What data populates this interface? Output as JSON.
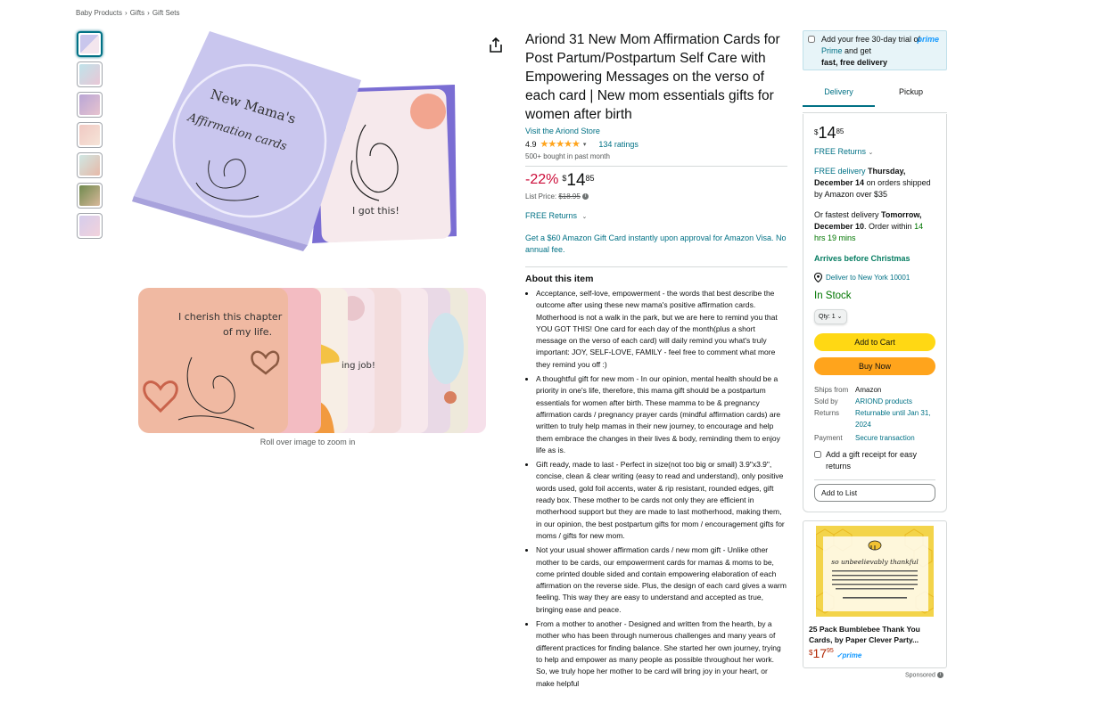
{
  "breadcrumb": {
    "items": [
      "Baby Products",
      "Gifts",
      "Gift Sets"
    ],
    "separator": "›"
  },
  "product": {
    "title": "Ariond 31 New Mom Affirmation Cards for Post Partum/Postpartum Self Care with Empowering Messages on the verso of each card | New mom essentials gifts for women after birth",
    "store_link": "Visit the Ariond Store",
    "rating": "4.9",
    "stars": "★★★★★",
    "ratings_count": "134 ratings",
    "bought": "500+ bought in past month",
    "discount": "-22%",
    "price_symbol": "$",
    "price_whole": "14",
    "price_fraction": "85",
    "list_price_label": "List Price:",
    "list_price": "$18.95",
    "free_returns": "FREE Returns",
    "gift_offer": "Get a $60 Amazon Gift Card instantly upon approval for Amazon Visa. No annual fee.",
    "zoom_hint": "Roll over image to zoom in",
    "box_title_line1": "New Mama's",
    "box_title_line2": "Affirmation cards",
    "card_text": "I got this!",
    "collage_text": "I cherish this chapter of my life.",
    "collage_text2": "ing job!"
  },
  "about": {
    "title": "About this item",
    "bullets": [
      "Acceptance, self-love, empowerment - the words that best describe the outcome after using these new mama's positive affirmation cards. Motherhood is not a walk in the park, but we are here to remind you that YOU GOT THIS! One card for each day of the month(plus a short message on the verso of each card) will daily remind you what's truly important: JOY, SELF-LOVE, FAMILY - feel free to comment what more they remind you off :)",
      "A thoughtful gift for new mom - In our opinion, mental health should be a priority in one's life, therefore, this mama gift should be a postpartum essentials for women after birth. These mamma to be & pregnancy affirmation cards / pregnancy prayer cards (mindful affirmation cards) are written to truly help mamas in their new journey, to encourage and help them embrace the changes in their lives & body, reminding them to enjoy life as is.",
      "Gift ready, made to last - Perfect in size(not too big or small) 3.9\"x3.9\", concise, clean & clear writing (easy to read and understand), only positive words used, gold foil accents, water & rip resistant, rounded edges, gift ready box. These mother to be cards not only they are efficient in motherhood support but they are made to last motherhood, making them, in our opinion, the best postpartum gifts for mom / encouragement gifts for moms / gifts for new mom.",
      "Not your usual shower affirmation cards / new mom gift - Unlike other mother to be cards, our empowerment cards for mamas & moms to be, come printed double sided and contain empowering elaboration of each affirmation on the reverse side. Plus, the design of each card gives a warm feeling. This way they are easy to understand and accepted as true, bringing ease and peace.",
      "From a mother to another - Designed and written from the hearth, by a mother who has been through numerous challenges and many years of different practices for finding balance. She started her own journey, trying to help and empower as many people as possible throughout her work. So, we truly hope her mother to be card will bring joy in your heart, or make helpful"
    ]
  },
  "prime_banner": {
    "text_pre": "Add your free 30-day trial of ",
    "prime_word": "Prime",
    "text_post": " and get",
    "bold": "fast, free delivery",
    "logo": "prime"
  },
  "tabs": {
    "delivery": "Delivery",
    "pickup": "Pickup"
  },
  "buybox": {
    "price_symbol": "$",
    "price_whole": "14",
    "price_fraction": "85",
    "free_returns": "FREE Returns",
    "free_delivery": "FREE delivery",
    "delivery_date": "Thursday, December 14",
    "delivery_condition": "on orders shipped by Amazon over $35",
    "fastest_pre": "Or fastest delivery",
    "fastest_date": "Tomorrow, December 10",
    "fastest_mid": ". Order within",
    "fastest_time": "14 hrs 19 mins",
    "arrives": "Arrives before Christmas",
    "deliver_to": "Deliver to New York 10001",
    "in_stock": "In Stock",
    "qty_label": "Qty: 1",
    "add_to_cart": "Add to Cart",
    "buy_now": "Buy Now",
    "ships_from_label": "Ships from",
    "ships_from": "Amazon",
    "sold_by_label": "Sold by",
    "sold_by": "ARIOND products",
    "returns_label": "Returns",
    "returns": "Returnable until Jan 31, 2024",
    "payment_label": "Payment",
    "payment": "Secure transaction",
    "gift_receipt": "Add a gift receipt for easy returns",
    "add_to_list": "Add to List"
  },
  "ad": {
    "title": "25 Pack Bumblebee Thank You Cards, by Paper Clever Party...",
    "price_symbol": "$",
    "price_whole": "17",
    "price_fraction": "95",
    "prime": "✓prime",
    "sponsored": "Sponsored",
    "card_title": "so unbeelievably thankful"
  },
  "colors": {
    "link": "#007185",
    "discount": "#cc0c39",
    "cart": "#ffd814",
    "buy": "#ffa41c",
    "stock": "#007600",
    "star": "#ffa41c"
  }
}
